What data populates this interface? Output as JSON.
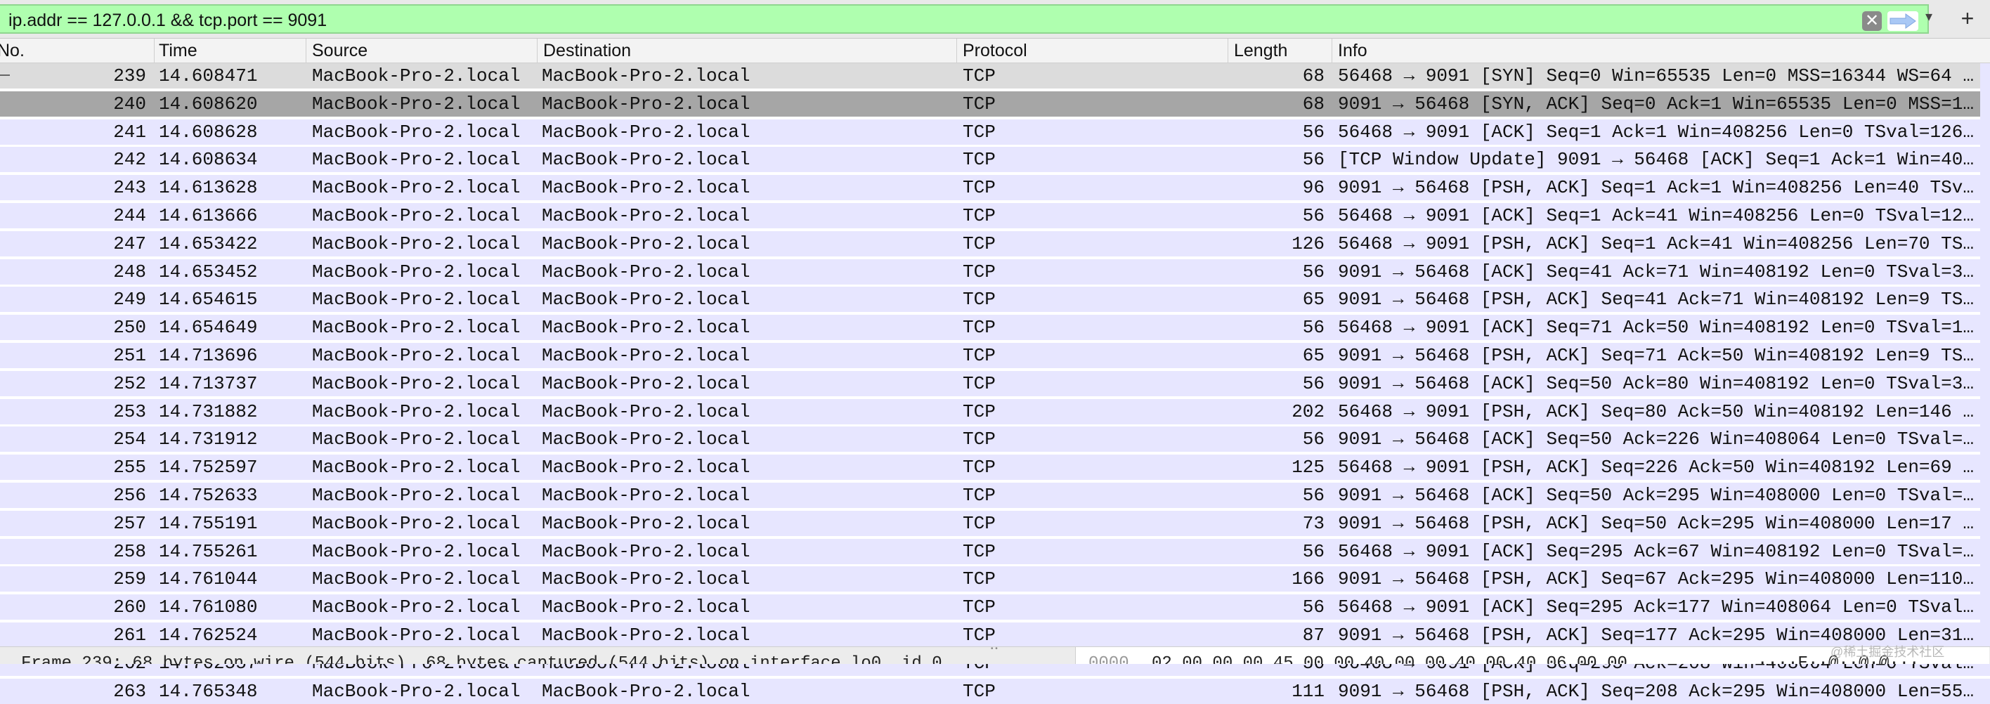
{
  "filter": {
    "text": "ip.addr == 127.0.0.1 && tcp.port == 9091",
    "clear_icon": "clear-icon",
    "apply_icon": "arrow-right-icon",
    "dropdown_icon": "chevron-down-icon",
    "add_label": "+"
  },
  "columns": [
    "No.",
    "Time",
    "Source",
    "Destination",
    "Protocol",
    "Length",
    "Info"
  ],
  "packets": [
    {
      "no": "239",
      "time": "14.608471",
      "src": "MacBook-Pro-2.local",
      "dst": "MacBook-Pro-2.local",
      "proto": "TCP",
      "len": "68",
      "info": "56468 → 9091 [SYN] Seq=0 Win=65535 Len=0 MSS=16344 WS=64 …"
    },
    {
      "no": "240",
      "time": "14.608620",
      "src": "MacBook-Pro-2.local",
      "dst": "MacBook-Pro-2.local",
      "proto": "TCP",
      "len": "68",
      "info": "9091 → 56468 [SYN, ACK] Seq=0 Ack=1 Win=65535 Len=0 MSS=1…"
    },
    {
      "no": "241",
      "time": "14.608628",
      "src": "MacBook-Pro-2.local",
      "dst": "MacBook-Pro-2.local",
      "proto": "TCP",
      "len": "56",
      "info": "56468 → 9091 [ACK] Seq=1 Ack=1 Win=408256 Len=0 TSval=126…"
    },
    {
      "no": "242",
      "time": "14.608634",
      "src": "MacBook-Pro-2.local",
      "dst": "MacBook-Pro-2.local",
      "proto": "TCP",
      "len": "56",
      "info": "[TCP Window Update] 9091 → 56468 [ACK] Seq=1 Ack=1 Win=40…"
    },
    {
      "no": "243",
      "time": "14.613628",
      "src": "MacBook-Pro-2.local",
      "dst": "MacBook-Pro-2.local",
      "proto": "TCP",
      "len": "96",
      "info": "9091 → 56468 [PSH, ACK] Seq=1 Ack=1 Win=408256 Len=40 TSv…"
    },
    {
      "no": "244",
      "time": "14.613666",
      "src": "MacBook-Pro-2.local",
      "dst": "MacBook-Pro-2.local",
      "proto": "TCP",
      "len": "56",
      "info": "56468 → 9091 [ACK] Seq=1 Ack=41 Win=408256 Len=0 TSval=12…"
    },
    {
      "no": "247",
      "time": "14.653422",
      "src": "MacBook-Pro-2.local",
      "dst": "MacBook-Pro-2.local",
      "proto": "TCP",
      "len": "126",
      "info": "56468 → 9091 [PSH, ACK] Seq=1 Ack=41 Win=408256 Len=70 TS…"
    },
    {
      "no": "248",
      "time": "14.653452",
      "src": "MacBook-Pro-2.local",
      "dst": "MacBook-Pro-2.local",
      "proto": "TCP",
      "len": "56",
      "info": "9091 → 56468 [ACK] Seq=41 Ack=71 Win=408192 Len=0 TSval=3…"
    },
    {
      "no": "249",
      "time": "14.654615",
      "src": "MacBook-Pro-2.local",
      "dst": "MacBook-Pro-2.local",
      "proto": "TCP",
      "len": "65",
      "info": "9091 → 56468 [PSH, ACK] Seq=41 Ack=71 Win=408192 Len=9 TS…"
    },
    {
      "no": "250",
      "time": "14.654649",
      "src": "MacBook-Pro-2.local",
      "dst": "MacBook-Pro-2.local",
      "proto": "TCP",
      "len": "56",
      "info": "56468 → 9091 [ACK] Seq=71 Ack=50 Win=408192 Len=0 TSval=1…"
    },
    {
      "no": "251",
      "time": "14.713696",
      "src": "MacBook-Pro-2.local",
      "dst": "MacBook-Pro-2.local",
      "proto": "TCP",
      "len": "65",
      "info": "9091 → 56468 [PSH, ACK] Seq=71 Ack=50 Win=408192 Len=9 TS…"
    },
    {
      "no": "252",
      "time": "14.713737",
      "src": "MacBook-Pro-2.local",
      "dst": "MacBook-Pro-2.local",
      "proto": "TCP",
      "len": "56",
      "info": "9091 → 56468 [ACK] Seq=50 Ack=80 Win=408192 Len=0 TSval=3…"
    },
    {
      "no": "253",
      "time": "14.731882",
      "src": "MacBook-Pro-2.local",
      "dst": "MacBook-Pro-2.local",
      "proto": "TCP",
      "len": "202",
      "info": "56468 → 9091 [PSH, ACK] Seq=80 Ack=50 Win=408192 Len=146 …"
    },
    {
      "no": "254",
      "time": "14.731912",
      "src": "MacBook-Pro-2.local",
      "dst": "MacBook-Pro-2.local",
      "proto": "TCP",
      "len": "56",
      "info": "9091 → 56468 [ACK] Seq=50 Ack=226 Win=408064 Len=0 TSval=…"
    },
    {
      "no": "255",
      "time": "14.752597",
      "src": "MacBook-Pro-2.local",
      "dst": "MacBook-Pro-2.local",
      "proto": "TCP",
      "len": "125",
      "info": "56468 → 9091 [PSH, ACK] Seq=226 Ack=50 Win=408192 Len=69 …"
    },
    {
      "no": "256",
      "time": "14.752633",
      "src": "MacBook-Pro-2.local",
      "dst": "MacBook-Pro-2.local",
      "proto": "TCP",
      "len": "56",
      "info": "9091 → 56468 [ACK] Seq=50 Ack=295 Win=408000 Len=0 TSval=…"
    },
    {
      "no": "257",
      "time": "14.755191",
      "src": "MacBook-Pro-2.local",
      "dst": "MacBook-Pro-2.local",
      "proto": "TCP",
      "len": "73",
      "info": "9091 → 56468 [PSH, ACK] Seq=50 Ack=295 Win=408000 Len=17 …"
    },
    {
      "no": "258",
      "time": "14.755261",
      "src": "MacBook-Pro-2.local",
      "dst": "MacBook-Pro-2.local",
      "proto": "TCP",
      "len": "56",
      "info": "56468 → 9091 [ACK] Seq=295 Ack=67 Win=408192 Len=0 TSval=…"
    },
    {
      "no": "259",
      "time": "14.761044",
      "src": "MacBook-Pro-2.local",
      "dst": "MacBook-Pro-2.local",
      "proto": "TCP",
      "len": "166",
      "info": "9091 → 56468 [PSH, ACK] Seq=67 Ack=295 Win=408000 Len=110…"
    },
    {
      "no": "260",
      "time": "14.761080",
      "src": "MacBook-Pro-2.local",
      "dst": "MacBook-Pro-2.local",
      "proto": "TCP",
      "len": "56",
      "info": "56468 → 9091 [ACK] Seq=295 Ack=177 Win=408064 Len=0 TSval…"
    },
    {
      "no": "261",
      "time": "14.762524",
      "src": "MacBook-Pro-2.local",
      "dst": "MacBook-Pro-2.local",
      "proto": "TCP",
      "len": "87",
      "info": "9091 → 56468 [PSH, ACK] Seq=177 Ack=295 Win=408000 Len=31…"
    },
    {
      "no": "262",
      "time": "14.762557",
      "src": "MacBook-Pro-2.local",
      "dst": "MacBook-Pro-2.local",
      "proto": "TCP",
      "len": "56",
      "info": "56468 → 9091 [ACK] Seq=295 Ack=208 Win=408064 Len=0 TSval…"
    },
    {
      "no": "263",
      "time": "14.765348",
      "src": "MacBook-Pro-2.local",
      "dst": "MacBook-Pro-2.local",
      "proto": "TCP",
      "len": "111",
      "info": "9091 → 56468 [PSH, ACK] Seq=208 Ack=295 Win=408000 Len=55…"
    }
  ],
  "selected_no": "240",
  "status": {
    "details_text": "Frame 239: 68 bytes on wire (544 bits), 68 bytes captured (544 bits) on interface lo0, id 0",
    "hex_offset": "0000",
    "hex_bytes": "02 00 00 00 45 00 00 40  00 00 40 00 40 06 00 00",
    "ascii": "····E··@··@·@···"
  },
  "watermark": "@稀土掘金技术社区",
  "colors": {
    "filter_ok": "#afffaf",
    "selected_row": "#a6a6a6",
    "tcp_row": "#e7e6ff"
  }
}
